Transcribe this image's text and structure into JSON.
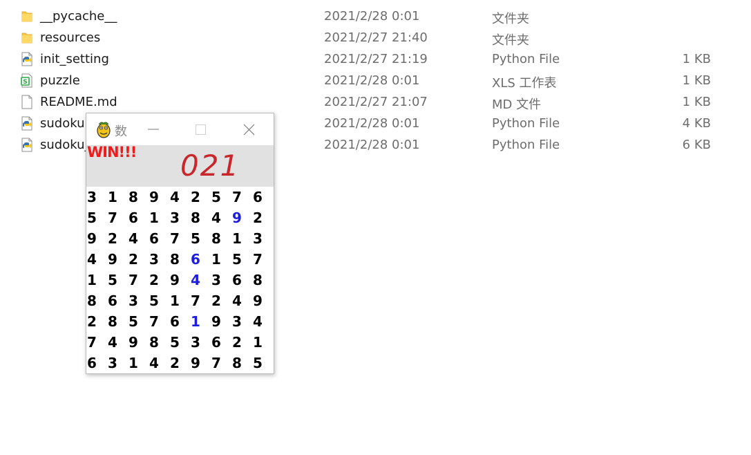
{
  "files": [
    {
      "name": "__pycache__",
      "date": "2021/2/28 0:01",
      "type": "文件夹",
      "size": "",
      "icon": "folder-icon"
    },
    {
      "name": "resources",
      "date": "2021/2/27 21:40",
      "type": "文件夹",
      "size": "",
      "icon": "folder-icon"
    },
    {
      "name": "init_setting",
      "date": "2021/2/27 21:19",
      "type": "Python File",
      "size": "1 KB",
      "icon": "python-file-icon"
    },
    {
      "name": "puzzle",
      "date": "2021/2/28 0:01",
      "type": "XLS 工作表",
      "size": "1 KB",
      "icon": "spreadsheet-file-icon"
    },
    {
      "name": "README.md",
      "date": "2021/2/27 21:07",
      "type": "MD 文件",
      "size": "1 KB",
      "icon": "document-file-icon"
    },
    {
      "name": "sudoku",
      "date": "2021/2/28 0:01",
      "type": "Python File",
      "size": "4 KB",
      "icon": "python-file-icon"
    },
    {
      "name": "sudoku_",
      "date": "2021/2/28 0:01",
      "type": "Python File",
      "size": "6 KB",
      "icon": "python-file-icon"
    }
  ],
  "window": {
    "title": "数",
    "app_icon": "pygame-snake-icon",
    "status_text": "WIN!!!",
    "timer": "021"
  },
  "colors": {
    "win_text": "#ee1c1c",
    "timer": "#c9252b",
    "user_digit": "#1d1de0",
    "given_digit": "#000000",
    "status_bg": "#e1e1e1"
  },
  "board": [
    [
      3,
      1,
      8,
      9,
      4,
      2,
      5,
      7,
      6
    ],
    [
      5,
      7,
      6,
      1,
      3,
      8,
      4,
      9,
      2
    ],
    [
      9,
      2,
      4,
      6,
      7,
      5,
      8,
      1,
      3
    ],
    [
      4,
      9,
      2,
      3,
      8,
      6,
      1,
      5,
      7
    ],
    [
      1,
      5,
      7,
      2,
      9,
      4,
      3,
      6,
      8
    ],
    [
      8,
      6,
      3,
      5,
      1,
      7,
      2,
      4,
      9
    ],
    [
      2,
      8,
      5,
      7,
      6,
      1,
      9,
      3,
      4
    ],
    [
      7,
      4,
      9,
      8,
      5,
      3,
      6,
      2,
      1
    ],
    [
      6,
      3,
      1,
      4,
      2,
      9,
      7,
      8,
      5
    ]
  ],
  "user_filled": [
    [
      1,
      7
    ],
    [
      3,
      5
    ],
    [
      4,
      5
    ],
    [
      6,
      5
    ]
  ]
}
